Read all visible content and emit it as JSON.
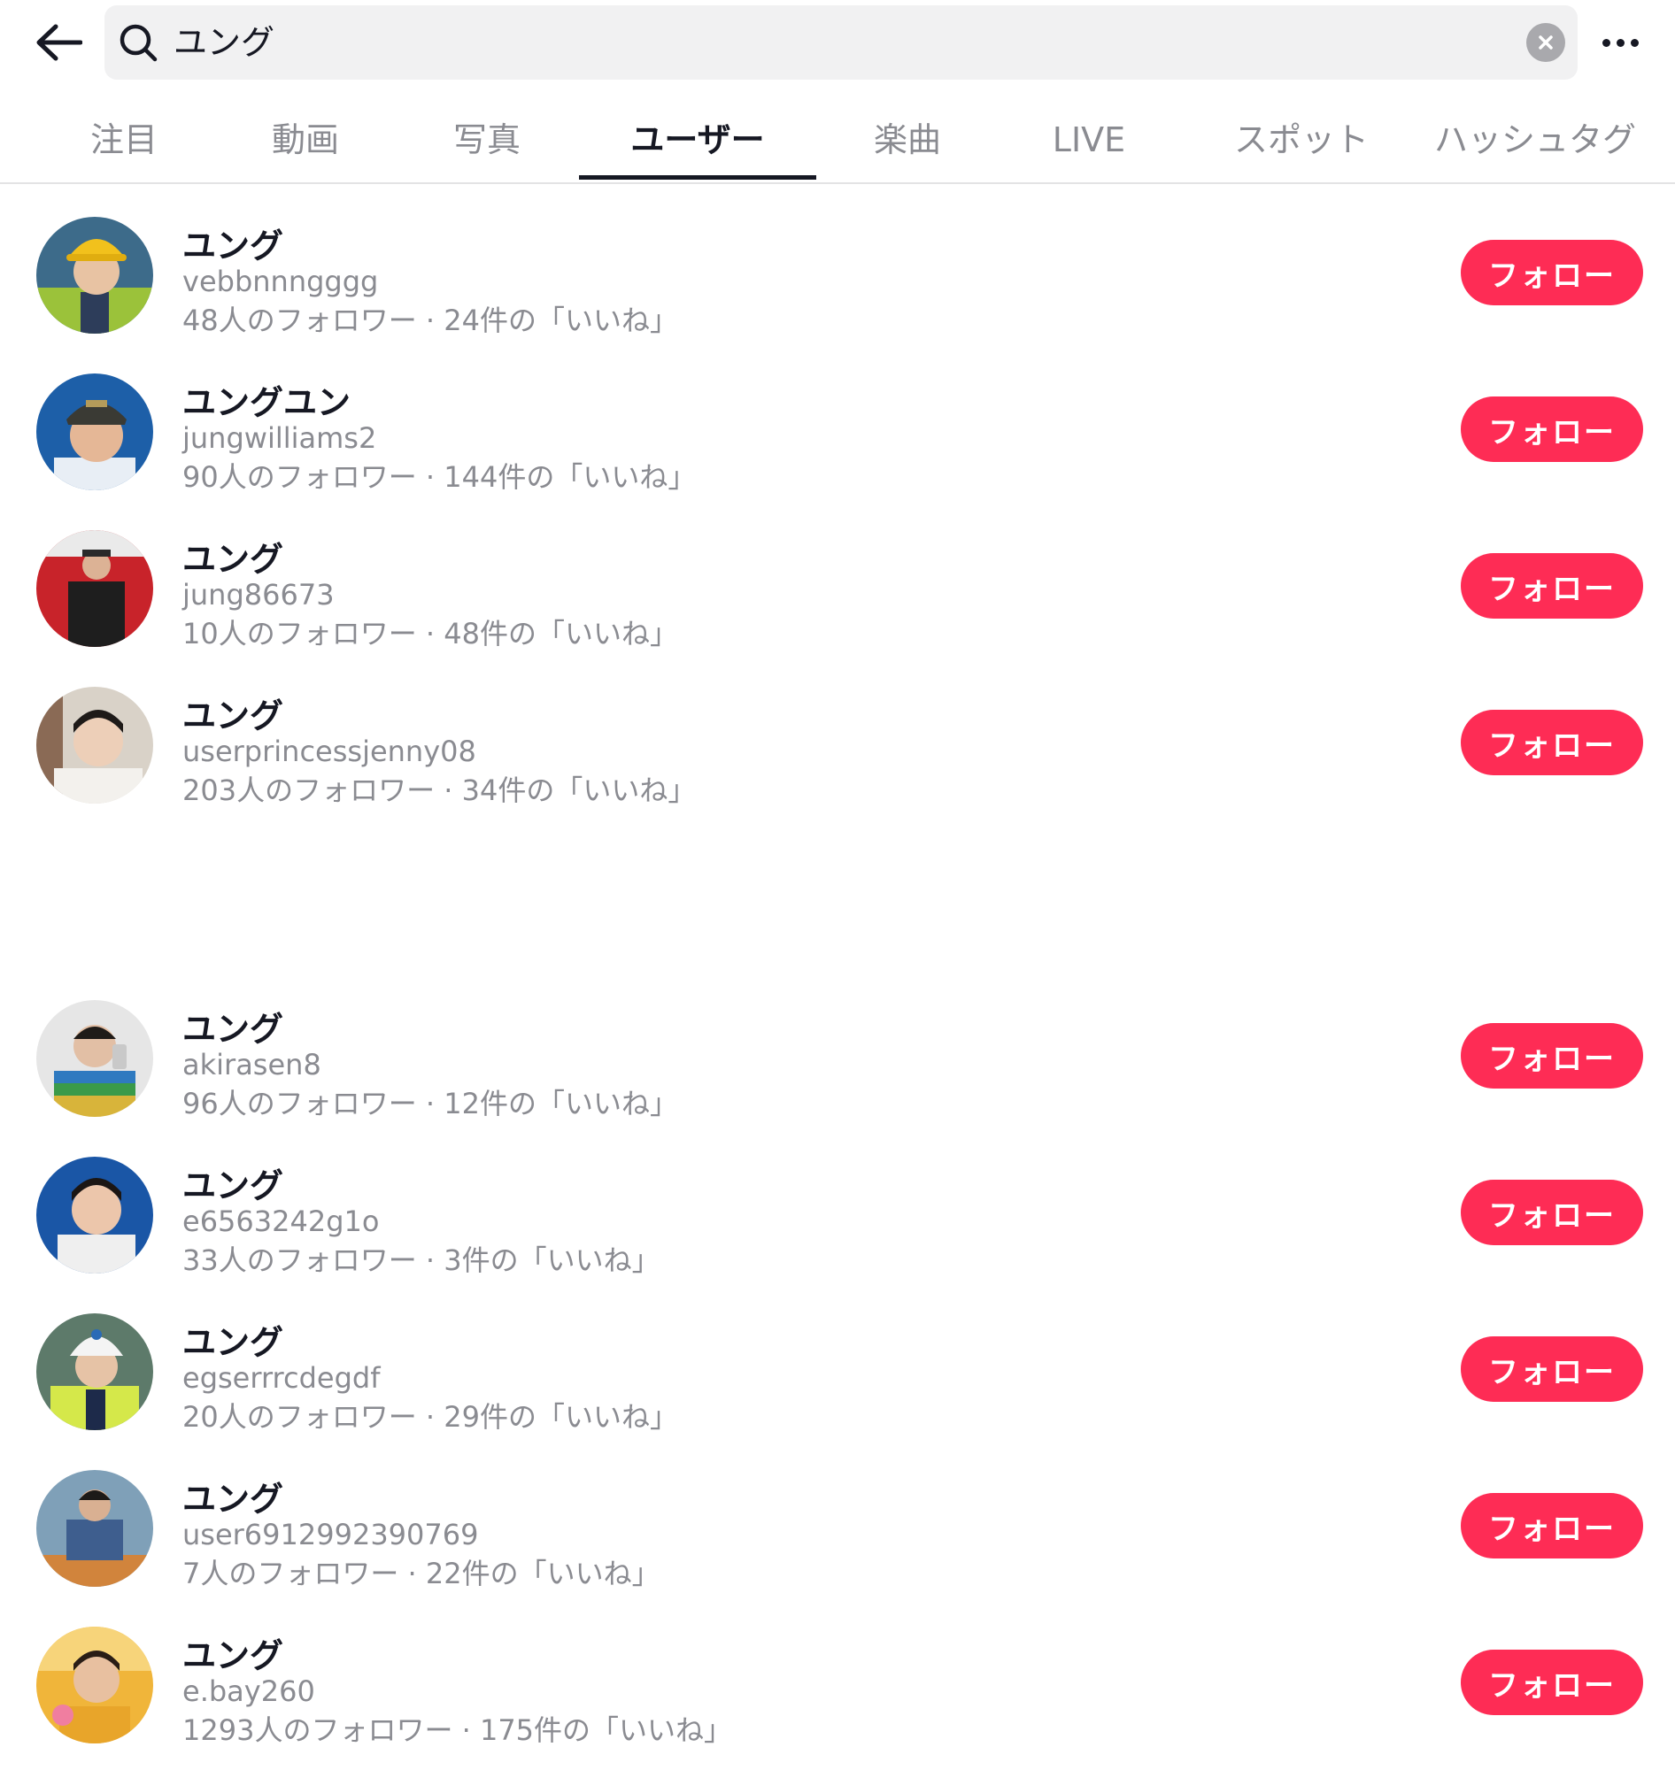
{
  "search": {
    "query": "ユング"
  },
  "tabs": [
    {
      "label": "注目"
    },
    {
      "label": "動画"
    },
    {
      "label": "写真"
    },
    {
      "label": "ユーザー"
    },
    {
      "label": "楽曲"
    },
    {
      "label": "LIVE"
    },
    {
      "label": "スポット"
    },
    {
      "label": "ハッシュタグ"
    }
  ],
  "active_tab": "ユーザー",
  "follow_label": "フォロー",
  "colors": {
    "accent": "#fe2c55",
    "text_primary": "#161823",
    "text_secondary": "#8a8b91"
  },
  "users": [
    {
      "name": "ユング",
      "handle": "vebbnnngggg",
      "stats": "48人のフォロワー · 24件の「いいね」"
    },
    {
      "name": "ユングユン",
      "handle": "jungwilliams2",
      "stats": "90人のフォロワー · 144件の「いいね」"
    },
    {
      "name": "ユング",
      "handle": "jung86673",
      "stats": "10人のフォロワー · 48件の「いいね」"
    },
    {
      "name": "ユング",
      "handle": "userprincessjenny08",
      "stats": "203人のフォロワー · 34件の「いいね」"
    },
    {
      "name": "ユング",
      "handle": "akirasen8",
      "stats": "96人のフォロワー · 12件の「いいね」"
    },
    {
      "name": "ユング",
      "handle": "e6563242g1o",
      "stats": "33人のフォロワー · 3件の「いいね」"
    },
    {
      "name": "ユング",
      "handle": "egserrrcdegdf",
      "stats": "20人のフォロワー · 29件の「いいね」"
    },
    {
      "name": "ユング",
      "handle": "user6912992390769",
      "stats": "7人のフォロワー · 22件の「いいね」"
    },
    {
      "name": "ユング",
      "handle": "e.bay260",
      "stats": "1293人のフォロワー · 175件の「いいね」"
    }
  ]
}
